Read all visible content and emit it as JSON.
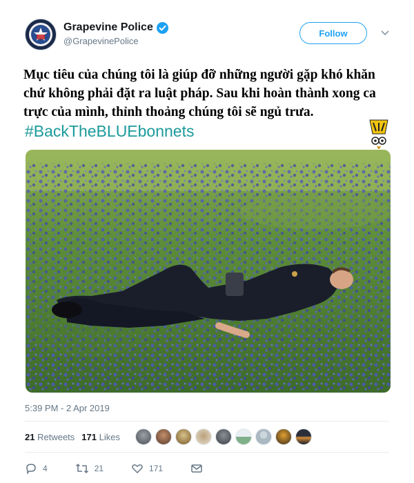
{
  "tweet": {
    "author": {
      "display_name": "Grapevine Police",
      "handle": "@GrapevinePolice",
      "verified": true
    },
    "follow_label": "Follow",
    "caption": "Mục tiêu của chúng tôi là giúp đỡ những người gặp khó khăn chứ không phải đặt ra luật pháp. Sau khi hoàn thành xong ca trực của mình, thỉnh thoảng chúng tôi sẽ ngủ trưa.",
    "hashtag": "#BackTheBLUEbonnets",
    "timestamp": "5:39 PM - 2 Apr 2019",
    "retweets_count": "21",
    "retweets_label": "Retweets",
    "likes_count": "171",
    "likes_label": "Likes",
    "actions": {
      "reply_count": "4",
      "retweet_count": "21",
      "like_count": "171"
    }
  },
  "icons": {
    "verified": "verified-badge-icon",
    "chevron": "chevron-down-icon",
    "reply": "reply-icon",
    "retweet": "retweet-icon",
    "like": "heart-icon",
    "message": "envelope-icon"
  },
  "colors": {
    "accent": "#1da1f2",
    "hashtag": "#1b9a9a",
    "muted": "#657786"
  }
}
